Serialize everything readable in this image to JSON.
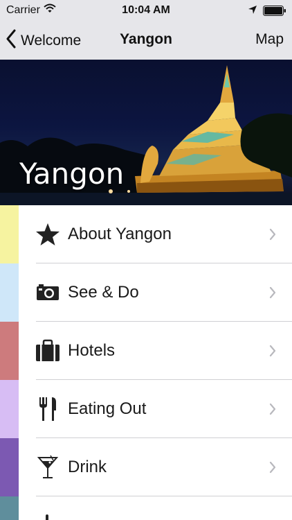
{
  "status_bar": {
    "carrier": "Carrier",
    "time": "10:04 AM",
    "icons": [
      "wifi-icon",
      "location-arrow-icon",
      "battery-icon"
    ]
  },
  "nav": {
    "back_label": "Welcome",
    "title": "Yangon",
    "right_label": "Map"
  },
  "hero": {
    "title": "Yangon"
  },
  "menu": {
    "items": [
      {
        "label": "About Yangon",
        "icon": "star-icon",
        "color": "#f6f3a0"
      },
      {
        "label": "See & Do",
        "icon": "camera-icon",
        "color": "#cfe7f9"
      },
      {
        "label": "Hotels",
        "icon": "suitcase-icon",
        "color": "#cd7b7d"
      },
      {
        "label": "Eating Out",
        "icon": "fork-knife-icon",
        "color": "#d7bdf4"
      },
      {
        "label": "Drink",
        "icon": "cocktail-glass-icon",
        "color": "#7c59b2"
      },
      {
        "label": "",
        "icon": "partial-icon",
        "color": "#5f8e9c"
      }
    ]
  },
  "colors": {
    "bar_bg": "#e6e6ea",
    "divider": "#cfcfd3",
    "chevron": "#b8b8bd"
  }
}
